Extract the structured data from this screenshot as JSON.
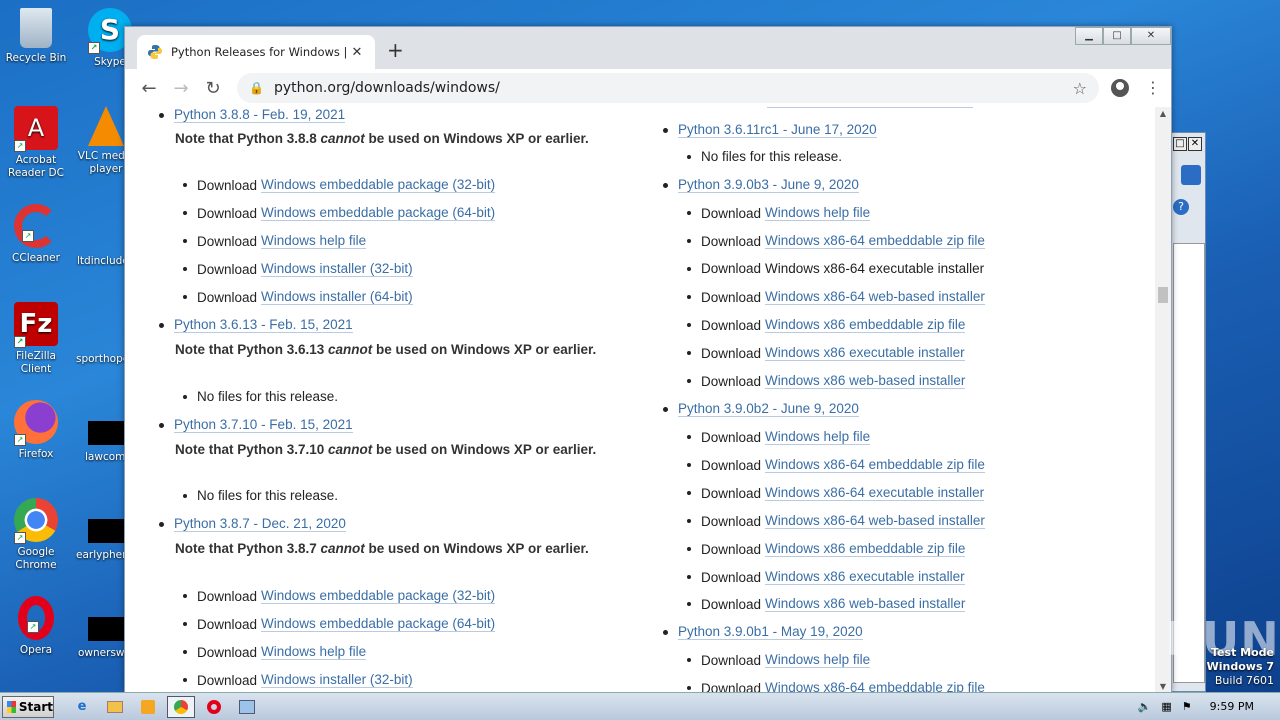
{
  "desktop": {
    "icons": [
      {
        "name": "recycle-bin",
        "label": "Recycle Bin"
      },
      {
        "name": "skype",
        "label": "Skype"
      },
      {
        "name": "acrobat",
        "label": "Acrobat Reader DC"
      },
      {
        "name": "vlc",
        "label": "VLC media player"
      },
      {
        "name": "ccleaner",
        "label": "CCleaner"
      },
      {
        "name": "ltdinclude",
        "label": "ltdinclude"
      },
      {
        "name": "filezilla",
        "label": "FileZilla Client"
      },
      {
        "name": "sporthope",
        "label": "sporthope"
      },
      {
        "name": "firefox",
        "label": "Firefox"
      },
      {
        "name": "lawcom",
        "label": "lawcom."
      },
      {
        "name": "chrome",
        "label": "Google Chrome"
      },
      {
        "name": "earlyphen",
        "label": "earlyphen"
      },
      {
        "name": "opera",
        "label": "Opera"
      },
      {
        "name": "ownerswi",
        "label": "ownerswi"
      }
    ]
  },
  "browser": {
    "tab_title": "Python Releases for Windows | Pyth",
    "url": "python.org/downloads/windows/",
    "new_tab_symbol": "+"
  },
  "page": {
    "left": [
      {
        "version": "Python 3.8.8 - Feb. 19, 2021",
        "note_pre": "Note that Python 3.8.8 ",
        "note_em": "cannot",
        "note_post": " be used on Windows XP or earlier.",
        "downloads": [
          "Windows embeddable package (32-bit)",
          "Windows embeddable package (64-bit)",
          "Windows help file",
          "Windows installer (32-bit)",
          "Windows installer (64-bit)"
        ]
      },
      {
        "version": "Python 3.6.13 - Feb. 15, 2021",
        "note_pre": "Note that Python 3.6.13 ",
        "note_em": "cannot",
        "note_post": " be used on Windows XP or earlier.",
        "nofiles": "No files for this release."
      },
      {
        "version": "Python 3.7.10 - Feb. 15, 2021",
        "note_pre": "Note that Python 3.7.10 ",
        "note_em": "cannot",
        "note_post": " be used on Windows XP or earlier.",
        "nofiles": "No files for this release."
      },
      {
        "version": "Python 3.8.7 - Dec. 21, 2020",
        "note_pre": "Note that Python 3.8.7 ",
        "note_em": "cannot",
        "note_post": " be used on Windows XP or earlier.",
        "downloads": [
          "Windows embeddable package (32-bit)",
          "Windows embeddable package (64-bit)",
          "Windows help file",
          "Windows installer (32-bit)"
        ]
      }
    ],
    "right": [
      {
        "version": "Python 3.6.11rc1 - June 17, 2020",
        "nofiles": "No files for this release."
      },
      {
        "version": "Python 3.9.0b3 - June 9, 2020",
        "downloads": [
          "Windows help file",
          "Windows x86-64 embeddable zip file",
          "Windows x86-64 executable installer",
          "Windows x86-64 web-based installer",
          "Windows x86 embeddable zip file",
          "Windows x86 executable installer",
          "Windows x86 web-based installer"
        ]
      },
      {
        "version": "Python 3.9.0b2 - June 9, 2020",
        "downloads": [
          "Windows help file",
          "Windows x86-64 embeddable zip file",
          "Windows x86-64 executable installer",
          "Windows x86-64 web-based installer",
          "Windows x86 embeddable zip file",
          "Windows x86 executable installer",
          "Windows x86 web-based installer"
        ]
      },
      {
        "version": "Python 3.9.0b1 - May 19, 2020",
        "downloads": [
          "Windows help file",
          "Windows x86-64 embeddable zip file"
        ]
      }
    ],
    "download_prefix": "Download"
  },
  "taskbar": {
    "start_label": "Start",
    "clock": "9:59 PM"
  },
  "watermark": {
    "line1": "Test Mode",
    "line2": "Windows 7",
    "line3": "Build 7601",
    "brand": "ANY RUN"
  }
}
